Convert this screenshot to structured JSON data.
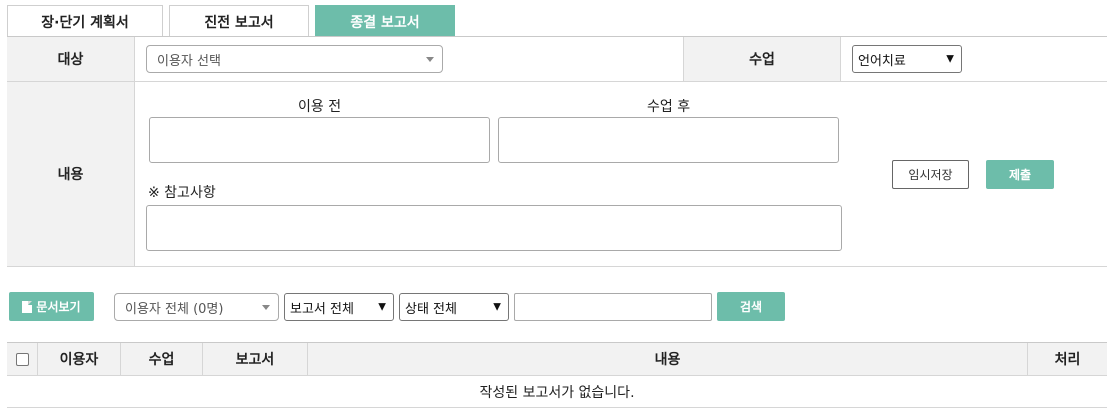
{
  "tabs": [
    {
      "label": "장·단기 계획서",
      "active": false
    },
    {
      "label": "진전 보고서",
      "active": false
    },
    {
      "label": "종결 보고서",
      "active": true
    }
  ],
  "form": {
    "target_label": "대상",
    "user_select": "이용자 선택",
    "class_label": "수업",
    "class_select": "언어치료",
    "content_label": "내용",
    "before_label": "이용 전",
    "after_label": "수업 후",
    "note_label": "※ 참고사항",
    "temp_save": "임시저장",
    "submit": "제출"
  },
  "toolbar": {
    "docs_button": "문서보기",
    "users_filter": "이용자 전체 (0명)",
    "report_filter": "보고서 전체",
    "status_filter": "상태 전체",
    "search_value": "",
    "search_button": "검색"
  },
  "table": {
    "columns": [
      "이용자",
      "수업",
      "보고서",
      "내용",
      "처리"
    ],
    "empty_message": "작성된 보고서가 없습니다."
  },
  "colors": {
    "accent": "#6dbdaa",
    "header_bg": "#f2f2f2"
  }
}
